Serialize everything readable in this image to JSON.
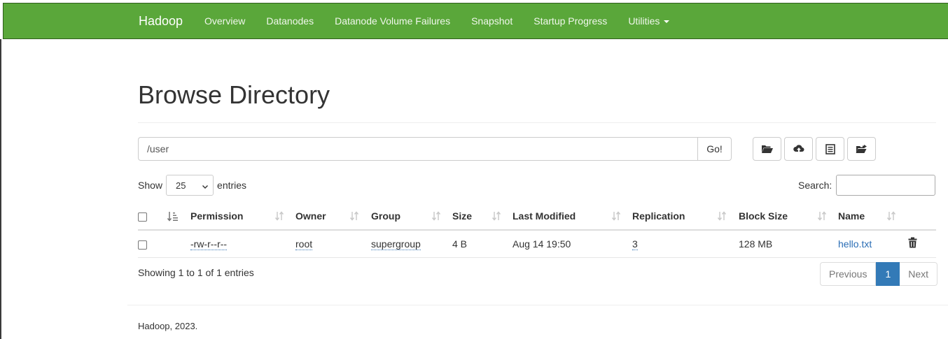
{
  "nav": {
    "brand": "Hadoop",
    "links": [
      "Overview",
      "Datanodes",
      "Datanode Volume Failures",
      "Snapshot",
      "Startup Progress",
      "Utilities"
    ]
  },
  "page": {
    "title": "Browse Directory"
  },
  "path": {
    "value": "/user",
    "go_label": "Go!"
  },
  "toolbar": {
    "icons": [
      "folder-open-icon",
      "cloud-upload-icon",
      "list-icon",
      "folder-move-icon"
    ]
  },
  "entries": {
    "show_label": "Show",
    "selected": "25",
    "suffix_label": "entries"
  },
  "search": {
    "label": "Search:",
    "value": ""
  },
  "table": {
    "columns": [
      "Permission",
      "Owner",
      "Group",
      "Size",
      "Last Modified",
      "Replication",
      "Block Size",
      "Name"
    ],
    "rows": [
      {
        "permission": "-rw-r--r--",
        "owner": "root",
        "group": "supergroup",
        "size": "4 B",
        "last_modified": "Aug 14 19:50",
        "replication": "3",
        "block_size": "128 MB",
        "name": "hello.txt"
      }
    ]
  },
  "info": {
    "text": "Showing 1 to 1 of 1 entries"
  },
  "pagination": {
    "previous": "Previous",
    "current": "1",
    "next": "Next"
  },
  "footer": {
    "text": "Hadoop, 2023."
  },
  "colors": {
    "navbar": "#5aa73a",
    "accent": "#337ab7",
    "link": "#2a6db5"
  }
}
